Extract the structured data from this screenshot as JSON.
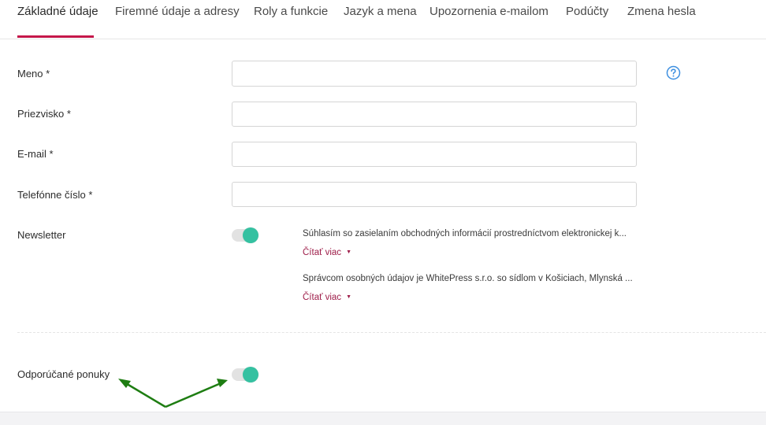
{
  "tabs": [
    {
      "label": "Základné údaje"
    },
    {
      "label": "Firemné údaje a adresy"
    },
    {
      "label": "Roly a funkcie"
    },
    {
      "label": "Jazyk a mena"
    },
    {
      "label": "Upozornenia e-mailom"
    },
    {
      "label": "Podúčty"
    },
    {
      "label": "Zmena hesla"
    }
  ],
  "form": {
    "first_name_label": "Meno *",
    "last_name_label": "Priezvisko *",
    "email_label": "E-mail *",
    "phone_label": "Telefónne číslo *",
    "newsletter_label": "Newsletter",
    "recommended_offers_label": "Odporúčané ponuky"
  },
  "consents": [
    {
      "text": "Súhlasím so zasielaním obchodných informácií prostredníctvom elektronickej k...",
      "read_more": "Čítať viac"
    },
    {
      "text": "Správcom osobných údajov je WhitePress s.r.o. so sídlom v Košiciach, Mlynská ...",
      "read_more": "Čítať viac"
    }
  ],
  "toggles": {
    "newsletter_on": true,
    "recommended_offers_on": true
  },
  "colors": {
    "accent": "#c5174a",
    "toggle_on": "#35c1a1",
    "link": "#9e1d49",
    "help": "#3d8fe0",
    "annotation_arrow": "#1e7d12"
  },
  "icons": {
    "help": "question-circle-icon",
    "caret": "caret-down-icon"
  }
}
